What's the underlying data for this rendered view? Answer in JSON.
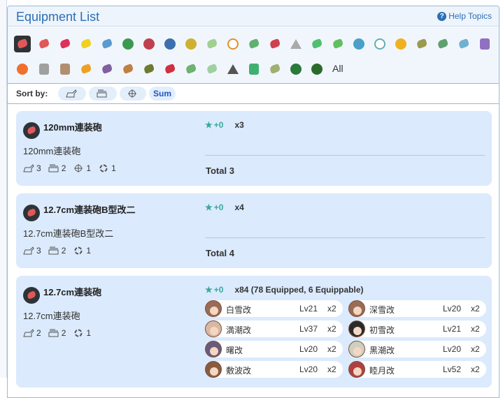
{
  "header": {
    "title": "Equipment List",
    "help_label": "Help Topics"
  },
  "filter_icons": {
    "row1": [
      "small-gun",
      "medium-gun",
      "large-gun",
      "secondary-gun",
      "torpedo",
      "fighter",
      "dive-bomber",
      "torpedo-bomber",
      "recon-plane",
      "seaplane",
      "radar",
      "aa-gun",
      "ap-shell",
      "depth-charge",
      "sonar",
      "engine",
      "landing-craft",
      "autogyro",
      "patrol-plane",
      "bulge",
      "searchlight",
      "drum",
      "repair",
      "food",
      "aa-fire-director",
      "rocket",
      "supply"
    ],
    "row2": [
      "personnel",
      "oil",
      "ration",
      "flare",
      "lookouts",
      "transport",
      "tank",
      "submarine-torpedo",
      "jet",
      "jet-bomber",
      "seaplane-fighter",
      "kit",
      "medal",
      "smoke",
      "land-attacker",
      "interceptor"
    ],
    "all_label": "All",
    "colors": {
      "selected_bg": "#2e3338",
      "gun_red": "#e05858"
    }
  },
  "sort": {
    "label": "Sort by:",
    "buttons": [
      "",
      "",
      "",
      "Sum"
    ],
    "active_index": 3
  },
  "cards": [
    {
      "name": "120mm連装砲",
      "subname": "120mm連装砲",
      "stats": [
        {
          "icon": "firepower-icon",
          "value": "3"
        },
        {
          "icon": "aa-icon",
          "value": "2"
        },
        {
          "icon": "accuracy-icon",
          "value": "1"
        },
        {
          "icon": "range-icon",
          "value": "1"
        }
      ],
      "improvement": "+0",
      "count": "x3",
      "total": "Total 3",
      "ships": []
    },
    {
      "name": "12.7cm連装砲B型改二",
      "subname": "12.7cm連装砲B型改二",
      "stats": [
        {
          "icon": "firepower-icon",
          "value": "3"
        },
        {
          "icon": "aa-icon",
          "value": "2"
        },
        {
          "icon": "range-icon",
          "value": "1"
        }
      ],
      "improvement": "+0",
      "count": "x4",
      "total": "Total 4",
      "ships": []
    },
    {
      "name": "12.7cm連装砲",
      "subname": "12.7cm連装砲",
      "stats": [
        {
          "icon": "firepower-icon",
          "value": "2"
        },
        {
          "icon": "aa-icon",
          "value": "2"
        },
        {
          "icon": "range-icon",
          "value": "1"
        }
      ],
      "improvement": "+0",
      "count": "x84 (78 Equipped, 6 Equippable)",
      "total": "",
      "ships": [
        {
          "name": "白雪改",
          "level": "Lv21",
          "count": "x2"
        },
        {
          "name": "深雪改",
          "level": "Lv20",
          "count": "x2"
        },
        {
          "name": "満潮改",
          "level": "Lv37",
          "count": "x2"
        },
        {
          "name": "初雪改",
          "level": "Lv21",
          "count": "x2"
        },
        {
          "name": "曙改",
          "level": "Lv20",
          "count": "x2"
        },
        {
          "name": "黒潮改",
          "level": "Lv20",
          "count": "x2"
        },
        {
          "name": "敷波改",
          "level": "Lv20",
          "count": "x2"
        },
        {
          "name": "睦月改",
          "level": "Lv52",
          "count": "x2"
        }
      ]
    }
  ]
}
